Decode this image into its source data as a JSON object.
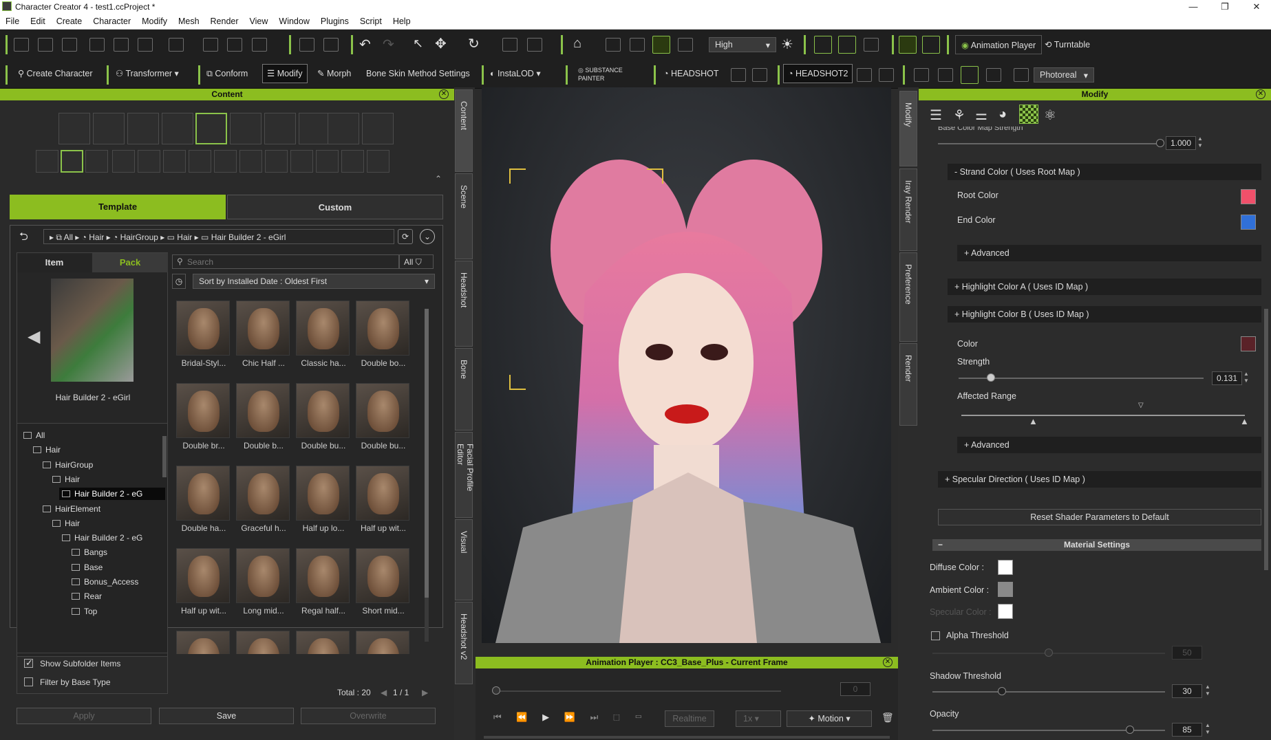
{
  "window": {
    "title": "Character Creator 4 - test1.ccProject *",
    "min": "—",
    "max": "❐",
    "close": "✕"
  },
  "menu": [
    "File",
    "Edit",
    "Create",
    "Character",
    "Modify",
    "Mesh",
    "Render",
    "View",
    "Window",
    "Plugins",
    "Script",
    "Help"
  ],
  "toolbar1": {
    "quality": "High",
    "animation_player": "Animation Player",
    "turntable": "Turntable"
  },
  "toolbar2": {
    "create_character": "Create Character",
    "transformer": "Transformer",
    "conform": "Conform",
    "modify": "Modify",
    "morph": "Morph",
    "bone_skin": "Bone Skin Method Settings",
    "instalod": "InstaLOD",
    "substance": "SUBSTANCE PAINTER",
    "headshot": "HEADSHOT",
    "headshot2": "HEADSHOT2",
    "render_mode": "Photoreal"
  },
  "content": {
    "title": "Content",
    "tabs": {
      "template": "Template",
      "custom": "Custom"
    },
    "breadcrumb": [
      "All",
      "Hair",
      "HairGroup",
      "Hair",
      "Hair Builder 2 - eGirl"
    ],
    "subtabs": {
      "item": "Item",
      "pack": "Pack"
    },
    "pack_name": "Hair Builder 2 - eGirl",
    "search_placeholder": "Search",
    "filter": "All",
    "sort": "Sort by Installed Date : Oldest First",
    "items": [
      "Bridal-Styl...",
      "Chic Half ...",
      "Classic ha...",
      "Double bo...",
      "Double br...",
      "Double b...",
      "Double bu...",
      "Double bu...",
      "Double ha...",
      "Graceful h...",
      "Half up lo...",
      "Half up wit...",
      "Half up wit...",
      "Long mid...",
      "Regal half...",
      "Short mid...",
      "",
      "",
      "",
      ""
    ],
    "tree": [
      {
        "label": "All",
        "level": 0
      },
      {
        "label": "Hair",
        "level": 1
      },
      {
        "label": "HairGroup",
        "level": 2
      },
      {
        "label": "Hair",
        "level": 3
      },
      {
        "label": "Hair Builder 2 - eG",
        "level": 4,
        "selected": true
      },
      {
        "label": "HairElement",
        "level": 2
      },
      {
        "label": "Hair",
        "level": 3
      },
      {
        "label": "Hair Builder 2 - eG",
        "level": 4
      },
      {
        "label": "Bangs",
        "level": 5
      },
      {
        "label": "Base",
        "level": 5
      },
      {
        "label": "Bonus_Access",
        "level": 5
      },
      {
        "label": "Rear",
        "level": 5
      },
      {
        "label": "Top",
        "level": 5
      }
    ],
    "show_subfolder": "Show Subfolder Items",
    "filter_base": "Filter by Base Type",
    "total": "Total : 20",
    "page": "1 / 1",
    "buttons": {
      "apply": "Apply",
      "save": "Save",
      "overwrite": "Overwrite"
    }
  },
  "side_tabs_left": [
    "Content",
    "Scene",
    "Headshot",
    "Bone",
    "Facial Profile Editor",
    "Visual",
    "Headshot v2"
  ],
  "side_tabs_right": [
    "Modify",
    "Iray Render",
    "Preference",
    "Render"
  ],
  "anim": {
    "title": "Animation Player : CC3_Base_Plus - Current Frame",
    "frame": "0",
    "realtime": "Realtime",
    "speed": "1x",
    "motion": "Motion"
  },
  "modify": {
    "title": "Modify",
    "partial_label": "Base Color Map Strength",
    "base_strength": "1.000",
    "strand_color": "-  Strand Color ( Uses Root Map )",
    "root_color_label": "Root Color",
    "root_color": "#f0506a",
    "end_color_label": "End Color",
    "end_color": "#3070d8",
    "advanced1": "+  Advanced",
    "highlight_a": "+  Highlight Color A ( Uses ID Map )",
    "highlight_b": "+  Highlight Color B ( Uses ID Map )",
    "color_label": "Color",
    "highlight_color": "#5a2228",
    "strength_label": "Strength",
    "strength": "0.131",
    "affected_range": "Affected Range",
    "advanced2": "+  Advanced",
    "specular_dir": "+  Specular Direction ( Uses ID Map )",
    "reset_btn": "Reset Shader Parameters to Default",
    "material_settings": "Material Settings",
    "diffuse": "Diffuse Color :",
    "ambient": "Ambient Color :",
    "specular": "Specular Color :",
    "alpha_threshold": "Alpha Threshold",
    "alpha_value": "50",
    "shadow_threshold": "Shadow Threshold",
    "shadow_value": "30",
    "opacity": "Opacity",
    "opacity_value": "85"
  }
}
